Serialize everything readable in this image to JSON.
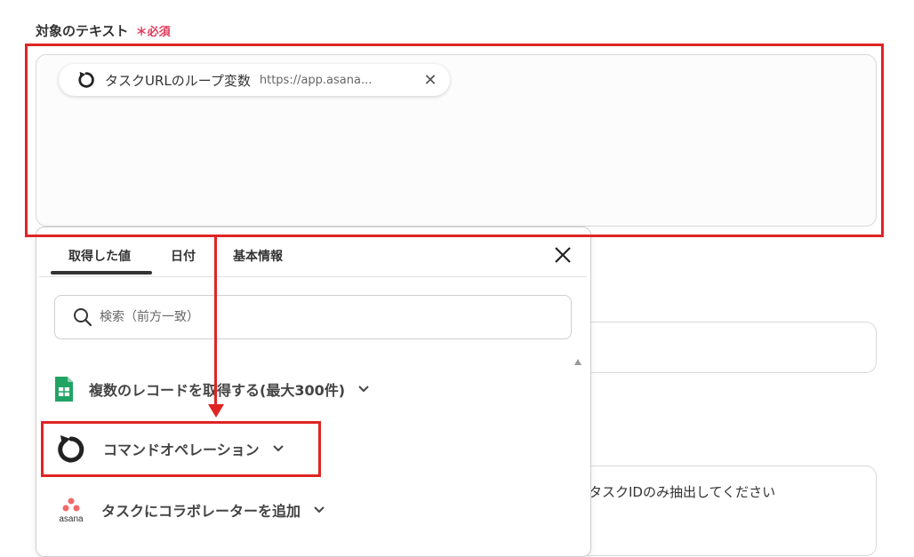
{
  "field": {
    "label": "対象のテキスト",
    "required_mark": "＊必須"
  },
  "chip": {
    "title": "タスクURLのループ変数",
    "value": "https://app.asana...",
    "icon": "loop-icon"
  },
  "panel": {
    "tabs": [
      {
        "label": "取得した値",
        "active": true
      },
      {
        "label": "日付",
        "active": false
      },
      {
        "label": "基本情報",
        "active": false
      }
    ],
    "search": {
      "placeholder": "検索（前方一致）"
    },
    "items": [
      {
        "label": "複数のレコードを取得する(最大300件)",
        "icon": "google-sheets-icon"
      },
      {
        "label": "コマンドオペレーション",
        "icon": "loop-icon"
      },
      {
        "label": "タスクにコラボレーターを追加",
        "icon": "asana-icon"
      }
    ]
  },
  "background": {
    "field2_text": "タスクIDのみ抽出してください"
  },
  "colors": {
    "highlight": "#e02424",
    "required": "#e33a5c",
    "sheets_green": "#1fa463"
  }
}
